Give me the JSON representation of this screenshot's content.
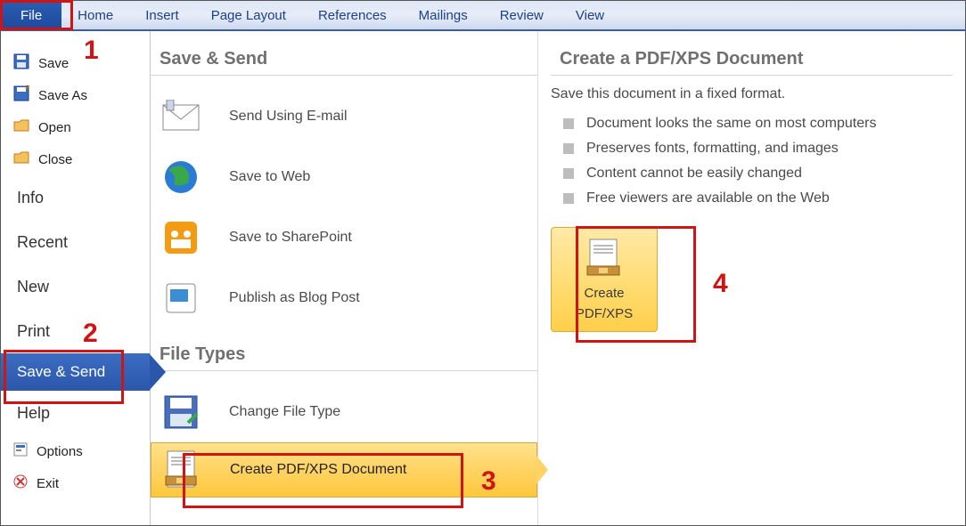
{
  "ribbon": {
    "tabs": [
      "File",
      "Home",
      "Insert",
      "Page Layout",
      "References",
      "Mailings",
      "Review",
      "View"
    ]
  },
  "sidebar": {
    "items_icons": [
      {
        "label": "Save"
      },
      {
        "label": "Save As"
      },
      {
        "label": "Open"
      },
      {
        "label": "Close"
      }
    ],
    "items_plain": [
      "Info",
      "Recent",
      "New",
      "Print"
    ],
    "selected": "Save & Send",
    "after": [
      "Help"
    ],
    "footer": [
      {
        "label": "Options"
      },
      {
        "label": "Exit"
      }
    ]
  },
  "col2": {
    "section1_title": "Save & Send",
    "section1_items": [
      "Send Using E-mail",
      "Save to Web",
      "Save to SharePoint",
      "Publish as Blog Post"
    ],
    "section2_title": "File Types",
    "section2_items": [
      "Change File Type",
      "Create PDF/XPS Document"
    ]
  },
  "col3": {
    "title": "Create a PDF/XPS Document",
    "desc": "Save this document in a fixed format.",
    "bullets": [
      "Document looks the same on most computers",
      "Preserves fonts, formatting, and images",
      "Content cannot be easily changed",
      "Free viewers are available on the Web"
    ],
    "button_line1": "Create",
    "button_line2": "PDF/XPS"
  },
  "callouts": {
    "one": "1",
    "two": "2",
    "three": "3",
    "four": "4"
  }
}
